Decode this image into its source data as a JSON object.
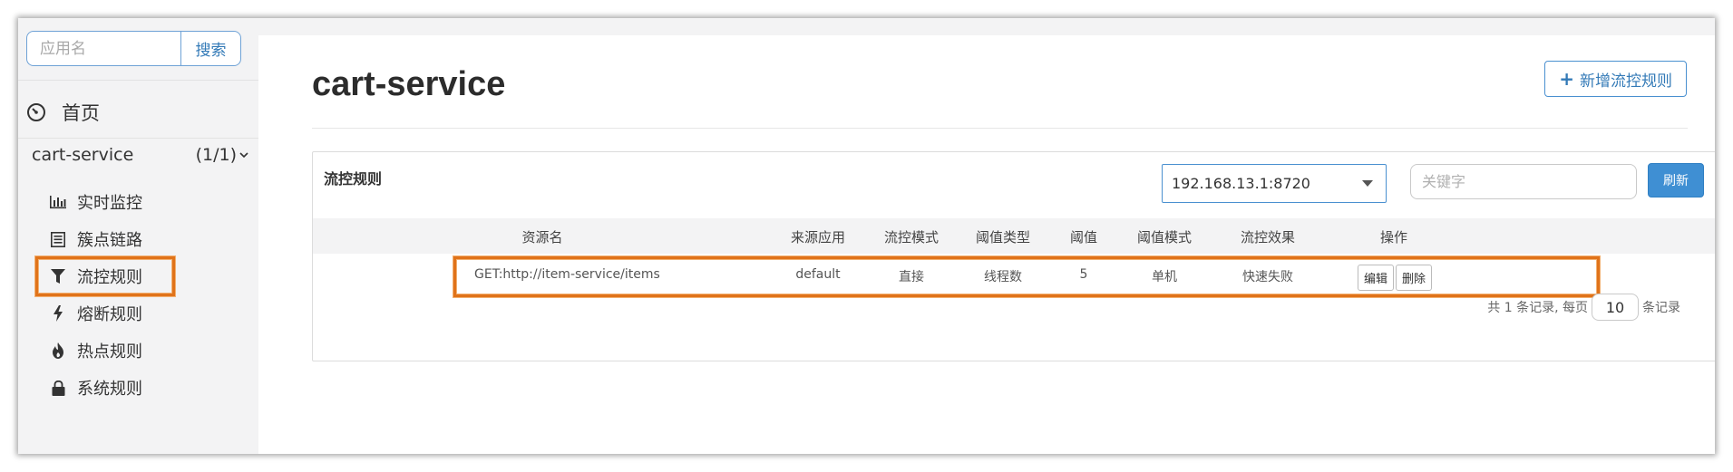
{
  "sidebar": {
    "search": {
      "placeholder": "应用名",
      "button": "搜索"
    },
    "home": {
      "label": "首页",
      "icon": "dashboard-icon"
    },
    "app": {
      "name": "cart-service",
      "count": "(1/1)"
    },
    "items": [
      {
        "label": "实时监控",
        "icon": "bar-chart-icon"
      },
      {
        "label": "簇点链路",
        "icon": "list-icon"
      },
      {
        "label": "流控规则",
        "icon": "filter-icon"
      },
      {
        "label": "熔断规则",
        "icon": "lightning-icon"
      },
      {
        "label": "热点规则",
        "icon": "fire-icon"
      },
      {
        "label": "系统规则",
        "icon": "lock-icon"
      }
    ],
    "active_item": "流控规则"
  },
  "main": {
    "title": "cart-service",
    "add_button": "新增流控规则",
    "panel": {
      "title": "流控规则",
      "machine": "192.168.13.1:8720",
      "keyword_placeholder": "关键字",
      "refresh": "刷新"
    },
    "table": {
      "columns": [
        "资源名",
        "来源应用",
        "流控模式",
        "阈值类型",
        "阈值",
        "阈值模式",
        "流控效果",
        "操作"
      ],
      "rows": [
        {
          "resource": "GET:http://item-service/items",
          "limit_app": "default",
          "mode": "直接",
          "threshold_type": "线程数",
          "threshold": "5",
          "cluster_mode": "单机",
          "effect": "快速失败",
          "edit": "编辑",
          "delete": "删除"
        }
      ]
    },
    "pager": {
      "prefix": "共 1 条记录, 每页",
      "page_size": "10",
      "suffix": "条记录"
    }
  },
  "colors": {
    "accent": "#337ab7",
    "highlight": "#e0731a",
    "primary_button": "#3f8fd3"
  }
}
